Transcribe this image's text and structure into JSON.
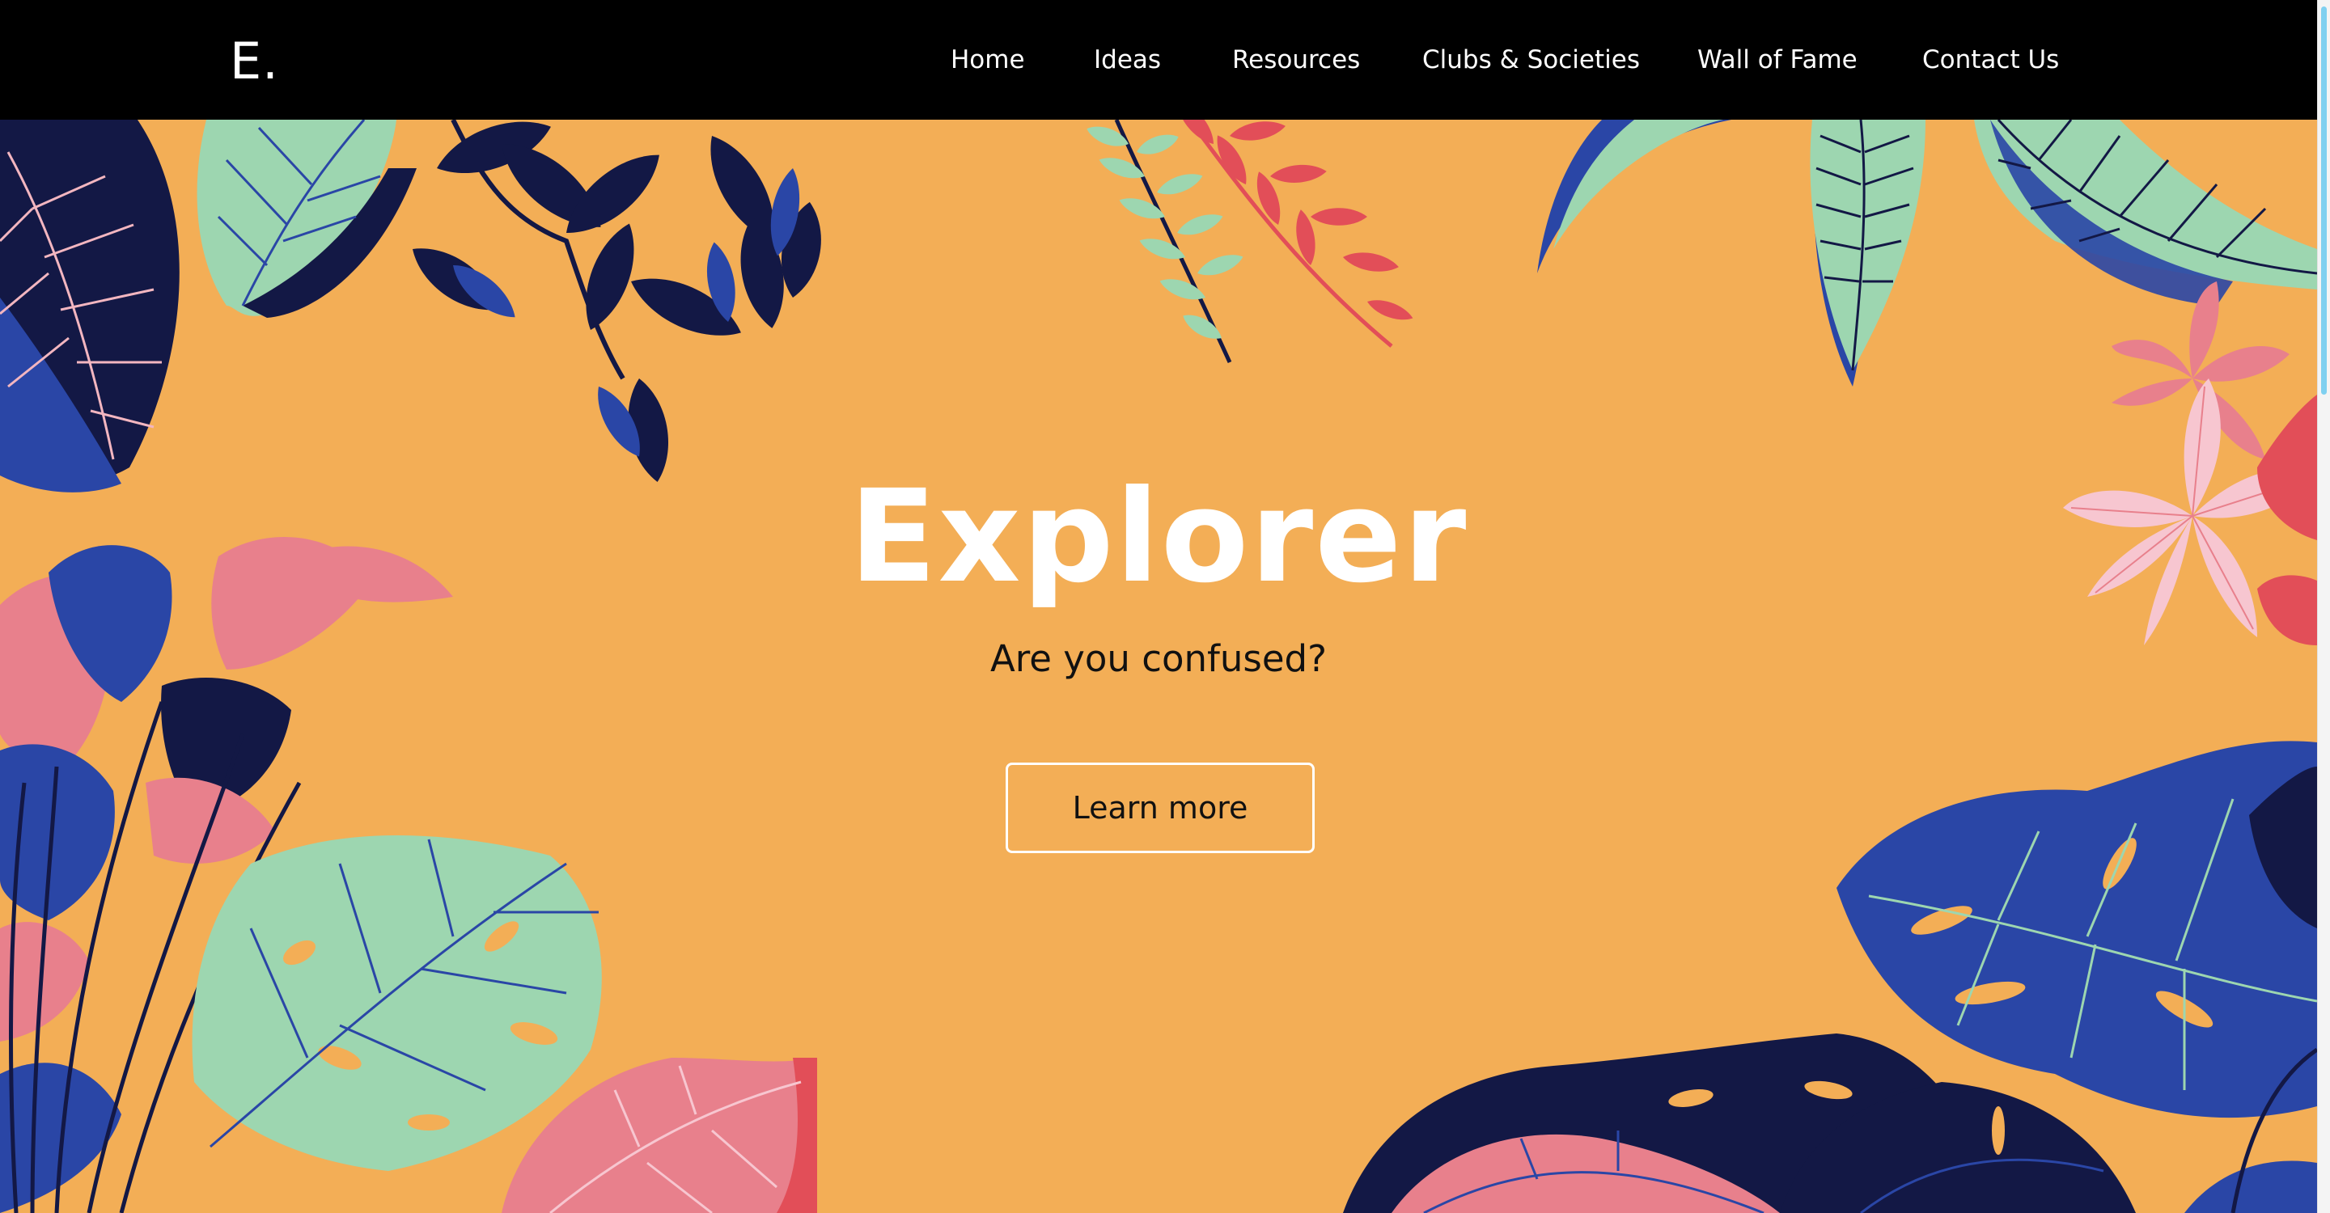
{
  "brand": {
    "logo_text": "E."
  },
  "nav": {
    "items": [
      "Home",
      "Ideas",
      "Resources",
      "Clubs & Societies",
      "Wall of Fame",
      "Contact Us"
    ]
  },
  "hero": {
    "title": "Explorer",
    "subtitle": "Are you confused?",
    "cta_label": "Learn more"
  },
  "colors": {
    "nav_background": "#000000",
    "hero_background": "#f3ae56",
    "leaf_navy": "#131845",
    "leaf_blue": "#2a46a6",
    "leaf_mint": "#9dd6b0",
    "leaf_pink": "#e8808c",
    "leaf_red": "#e24e58",
    "leaf_light_pink": "#f7c6d0"
  }
}
